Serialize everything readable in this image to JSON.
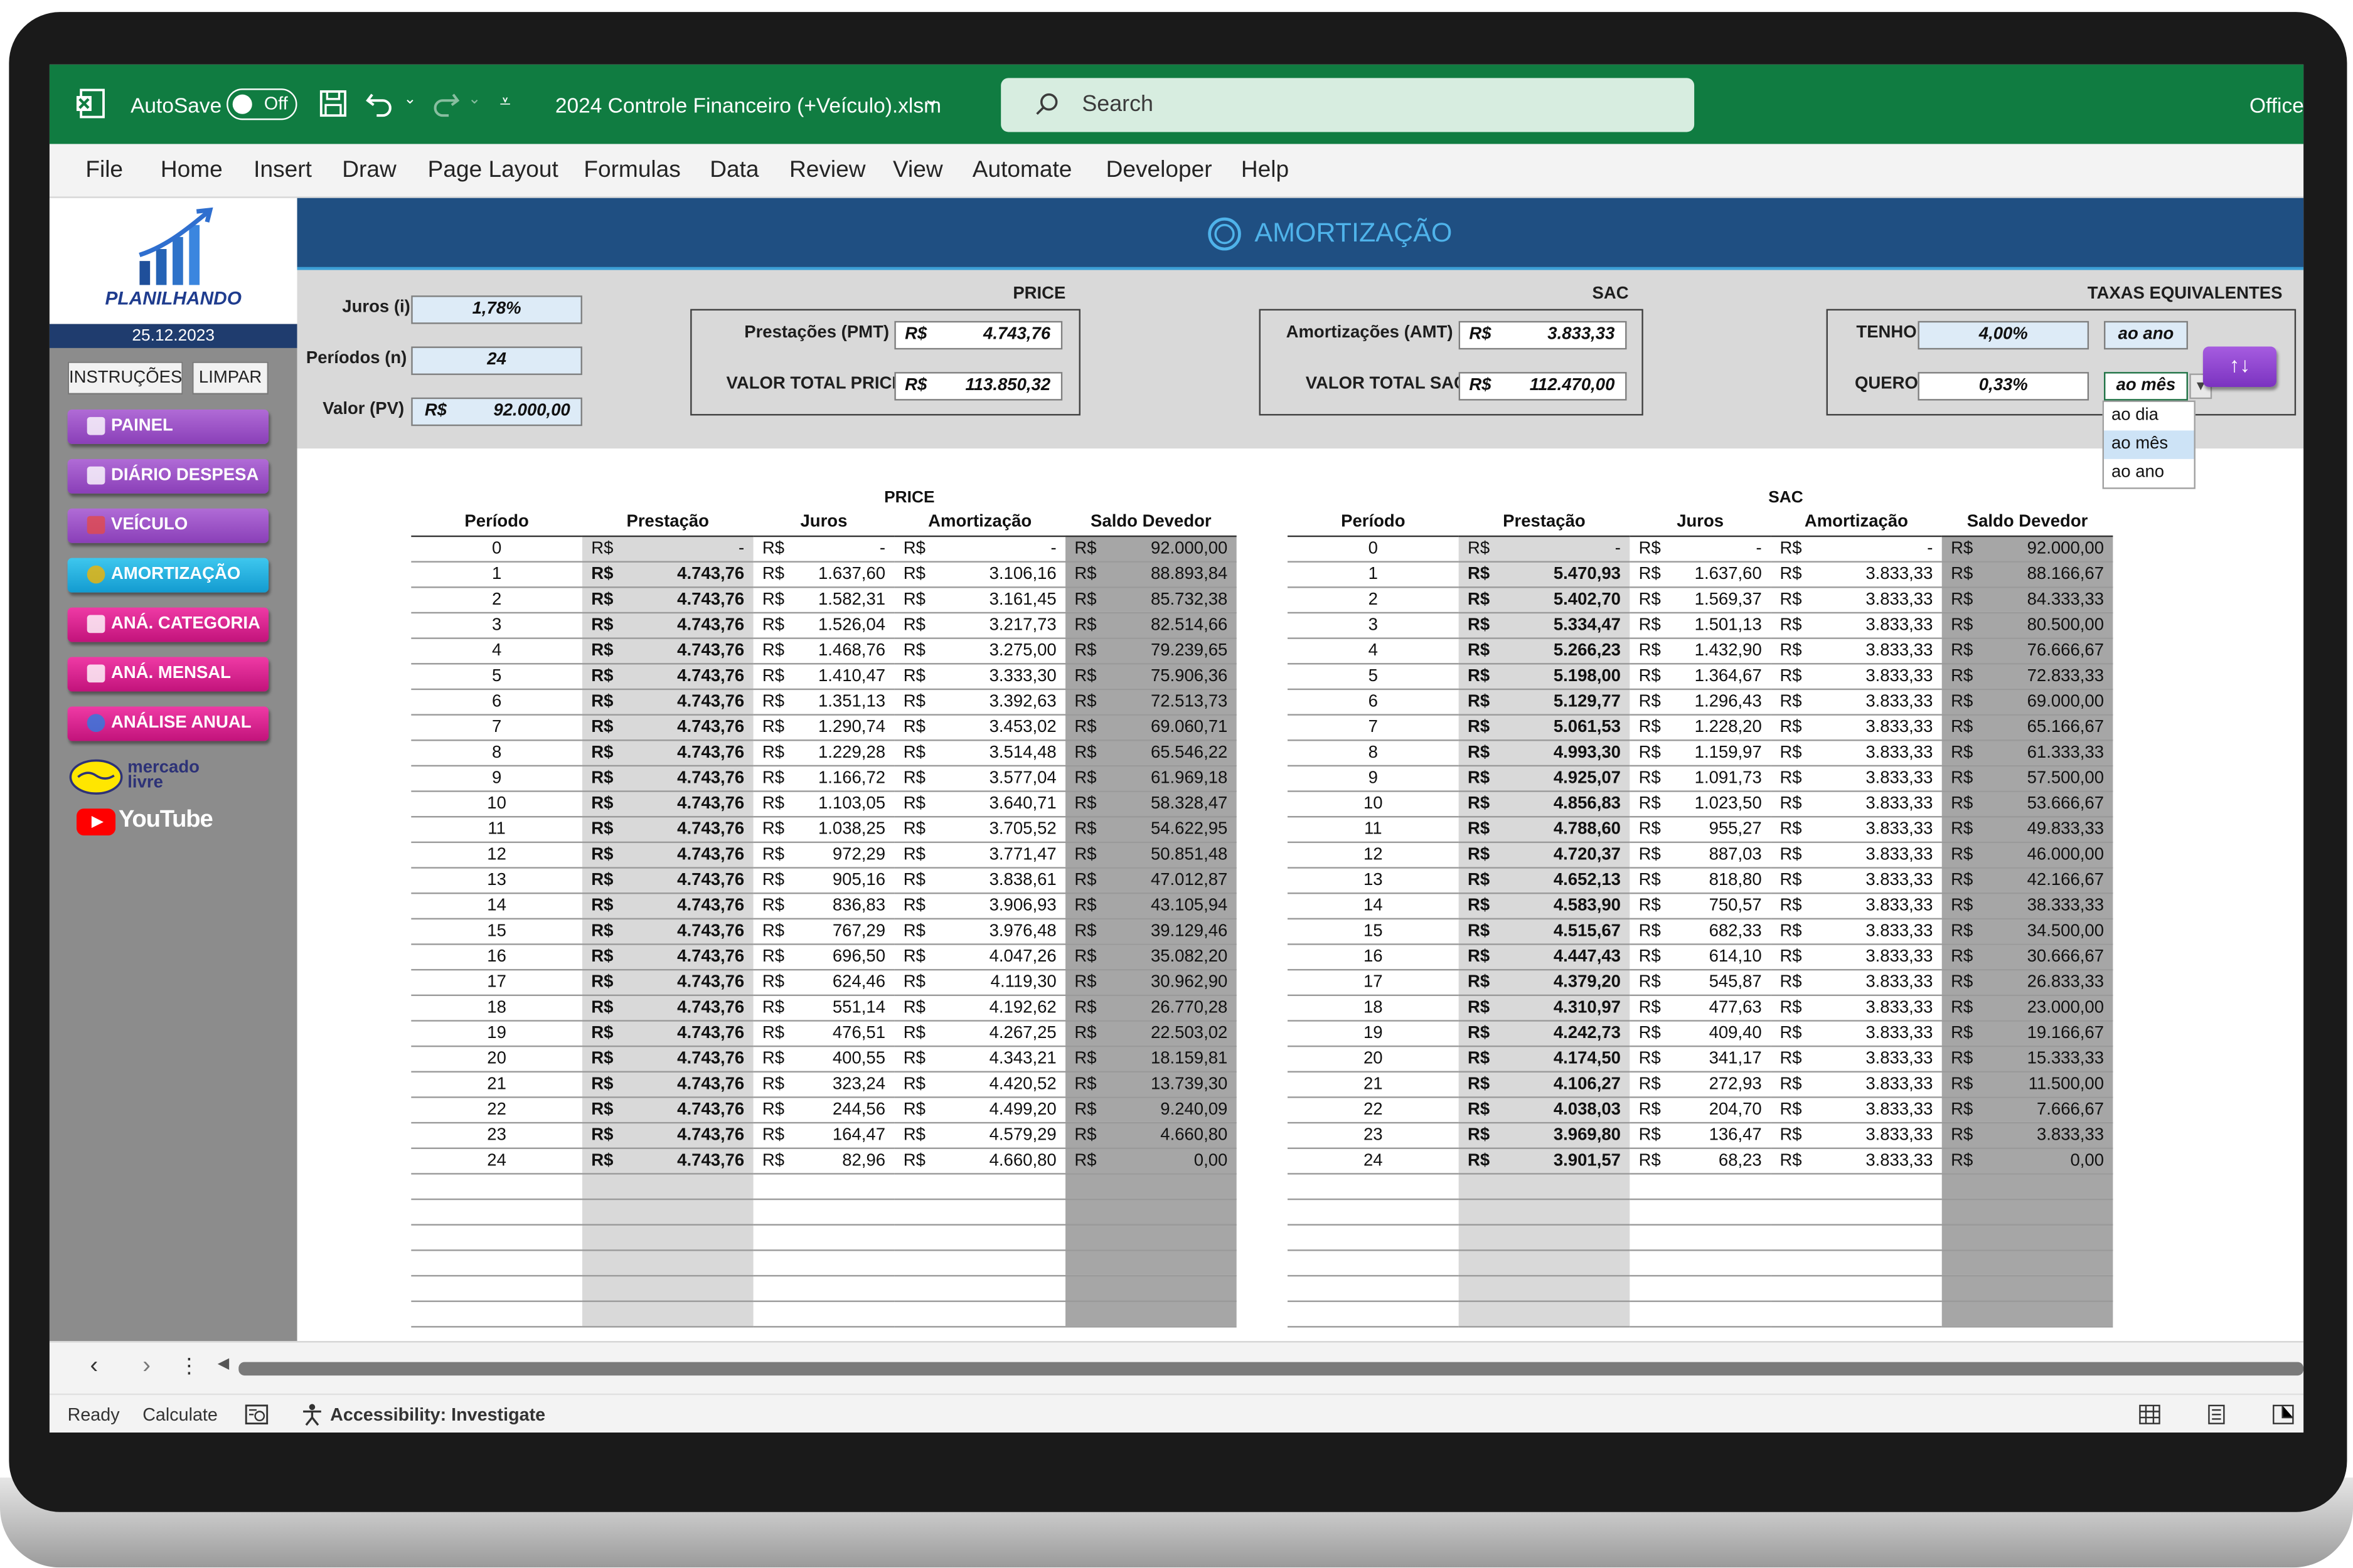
{
  "titlebar": {
    "autosave_label": "AutoSave",
    "toggle_state": "Off",
    "filename": "2024 Controle Financeiro (+Veículo).xlsm",
    "search_placeholder": "Search",
    "account": "Office"
  },
  "menu": [
    "File",
    "Home",
    "Insert",
    "Draw",
    "Page Layout",
    "Formulas",
    "Data",
    "Review",
    "View",
    "Automate",
    "Developer",
    "Help"
  ],
  "sidebar": {
    "logo_text": "PLANILHANDO",
    "date": "25.12.2023",
    "buttons": {
      "instructions": "INSTRUÇÕES",
      "clear": "LIMPAR"
    },
    "nav": [
      "PAINEL",
      "DIÁRIO DESPESA",
      "VEÍCULO",
      "AMORTIZAÇÃO",
      "ANÁ. CATEGORIA",
      "ANÁ. MENSAL",
      "ANÁLISE ANUAL"
    ],
    "mercadolivre": "mercado livre",
    "youtube": "YouTube"
  },
  "banner": {
    "title": "AMORTIZAÇÃO"
  },
  "inputs": {
    "juros_label": "Juros (i)",
    "juros_value": "1,78%",
    "periodos_label": "Períodos (n)",
    "periodos_value": "24",
    "valor_label": "Valor (PV)",
    "valor_cur": "R$",
    "valor_value": "92.000,00"
  },
  "price_summary": {
    "title": "PRICE",
    "pmt_label": "Prestações (PMT)",
    "pmt_cur": "R$",
    "pmt_value": "4.743,76",
    "total_label": "VALOR TOTAL PRICE",
    "total_cur": "R$",
    "total_value": "113.850,32"
  },
  "sac_summary": {
    "title": "SAC",
    "amt_label": "Amortizações (AMT)",
    "amt_cur": "R$",
    "amt_value": "3.833,33",
    "total_label": "VALOR TOTAL SAC",
    "total_cur": "R$",
    "total_value": "112.470,00"
  },
  "taxas": {
    "title": "TAXAS EQUIVALENTES",
    "tenho_label": "TENHO",
    "tenho_value": "4,00%",
    "tenho_unit": "ao ano",
    "quero_label": "QUERO",
    "quero_value": "0,33%",
    "quero_unit": "ao mês",
    "options": [
      "ao dia",
      "ao mês",
      "ao ano"
    ],
    "swap_label": "↑↓"
  },
  "table_headers": {
    "periodo": "Período",
    "prestacao": "Prestação",
    "juros": "Juros",
    "amortizacao": "Amortização",
    "saldo": "Saldo Devedor",
    "currency": "R$"
  },
  "price_table": {
    "title": "PRICE",
    "rows": [
      [
        "0",
        "-",
        "-",
        "-",
        "92.000,00"
      ],
      [
        "1",
        "4.743,76",
        "1.637,60",
        "3.106,16",
        "88.893,84"
      ],
      [
        "2",
        "4.743,76",
        "1.582,31",
        "3.161,45",
        "85.732,38"
      ],
      [
        "3",
        "4.743,76",
        "1.526,04",
        "3.217,73",
        "82.514,66"
      ],
      [
        "4",
        "4.743,76",
        "1.468,76",
        "3.275,00",
        "79.239,65"
      ],
      [
        "5",
        "4.743,76",
        "1.410,47",
        "3.333,30",
        "75.906,36"
      ],
      [
        "6",
        "4.743,76",
        "1.351,13",
        "3.392,63",
        "72.513,73"
      ],
      [
        "7",
        "4.743,76",
        "1.290,74",
        "3.453,02",
        "69.060,71"
      ],
      [
        "8",
        "4.743,76",
        "1.229,28",
        "3.514,48",
        "65.546,22"
      ],
      [
        "9",
        "4.743,76",
        "1.166,72",
        "3.577,04",
        "61.969,18"
      ],
      [
        "10",
        "4.743,76",
        "1.103,05",
        "3.640,71",
        "58.328,47"
      ],
      [
        "11",
        "4.743,76",
        "1.038,25",
        "3.705,52",
        "54.622,95"
      ],
      [
        "12",
        "4.743,76",
        "972,29",
        "3.771,47",
        "50.851,48"
      ],
      [
        "13",
        "4.743,76",
        "905,16",
        "3.838,61",
        "47.012,87"
      ],
      [
        "14",
        "4.743,76",
        "836,83",
        "3.906,93",
        "43.105,94"
      ],
      [
        "15",
        "4.743,76",
        "767,29",
        "3.976,48",
        "39.129,46"
      ],
      [
        "16",
        "4.743,76",
        "696,50",
        "4.047,26",
        "35.082,20"
      ],
      [
        "17",
        "4.743,76",
        "624,46",
        "4.119,30",
        "30.962,90"
      ],
      [
        "18",
        "4.743,76",
        "551,14",
        "4.192,62",
        "26.770,28"
      ],
      [
        "19",
        "4.743,76",
        "476,51",
        "4.267,25",
        "22.503,02"
      ],
      [
        "20",
        "4.743,76",
        "400,55",
        "4.343,21",
        "18.159,81"
      ],
      [
        "21",
        "4.743,76",
        "323,24",
        "4.420,52",
        "13.739,30"
      ],
      [
        "22",
        "4.743,76",
        "244,56",
        "4.499,20",
        "9.240,09"
      ],
      [
        "23",
        "4.743,76",
        "164,47",
        "4.579,29",
        "4.660,80"
      ],
      [
        "24",
        "4.743,76",
        "82,96",
        "4.660,80",
        "0,00"
      ]
    ]
  },
  "sac_table": {
    "title": "SAC",
    "rows": [
      [
        "0",
        "-",
        "-",
        "-",
        "92.000,00"
      ],
      [
        "1",
        "5.470,93",
        "1.637,60",
        "3.833,33",
        "88.166,67"
      ],
      [
        "2",
        "5.402,70",
        "1.569,37",
        "3.833,33",
        "84.333,33"
      ],
      [
        "3",
        "5.334,47",
        "1.501,13",
        "3.833,33",
        "80.500,00"
      ],
      [
        "4",
        "5.266,23",
        "1.432,90",
        "3.833,33",
        "76.666,67"
      ],
      [
        "5",
        "5.198,00",
        "1.364,67",
        "3.833,33",
        "72.833,33"
      ],
      [
        "6",
        "5.129,77",
        "1.296,43",
        "3.833,33",
        "69.000,00"
      ],
      [
        "7",
        "5.061,53",
        "1.228,20",
        "3.833,33",
        "65.166,67"
      ],
      [
        "8",
        "4.993,30",
        "1.159,97",
        "3.833,33",
        "61.333,33"
      ],
      [
        "9",
        "4.925,07",
        "1.091,73",
        "3.833,33",
        "57.500,00"
      ],
      [
        "10",
        "4.856,83",
        "1.023,50",
        "3.833,33",
        "53.666,67"
      ],
      [
        "11",
        "4.788,60",
        "955,27",
        "3.833,33",
        "49.833,33"
      ],
      [
        "12",
        "4.720,37",
        "887,03",
        "3.833,33",
        "46.000,00"
      ],
      [
        "13",
        "4.652,13",
        "818,80",
        "3.833,33",
        "42.166,67"
      ],
      [
        "14",
        "4.583,90",
        "750,57",
        "3.833,33",
        "38.333,33"
      ],
      [
        "15",
        "4.515,67",
        "682,33",
        "3.833,33",
        "34.500,00"
      ],
      [
        "16",
        "4.447,43",
        "614,10",
        "3.833,33",
        "30.666,67"
      ],
      [
        "17",
        "4.379,20",
        "545,87",
        "3.833,33",
        "26.833,33"
      ],
      [
        "18",
        "4.310,97",
        "477,63",
        "3.833,33",
        "23.000,00"
      ],
      [
        "19",
        "4.242,73",
        "409,40",
        "3.833,33",
        "19.166,67"
      ],
      [
        "20",
        "4.174,50",
        "341,17",
        "3.833,33",
        "15.333,33"
      ],
      [
        "21",
        "4.106,27",
        "272,93",
        "3.833,33",
        "11.500,00"
      ],
      [
        "22",
        "4.038,03",
        "204,70",
        "3.833,33",
        "7.666,67"
      ],
      [
        "23",
        "3.969,80",
        "136,47",
        "3.833,33",
        "3.833,33"
      ],
      [
        "24",
        "3.901,57",
        "68,23",
        "3.833,33",
        "0,00"
      ]
    ]
  },
  "status": {
    "ready": "Ready",
    "calculate": "Calculate",
    "accessibility": "Accessibility: Investigate"
  }
}
